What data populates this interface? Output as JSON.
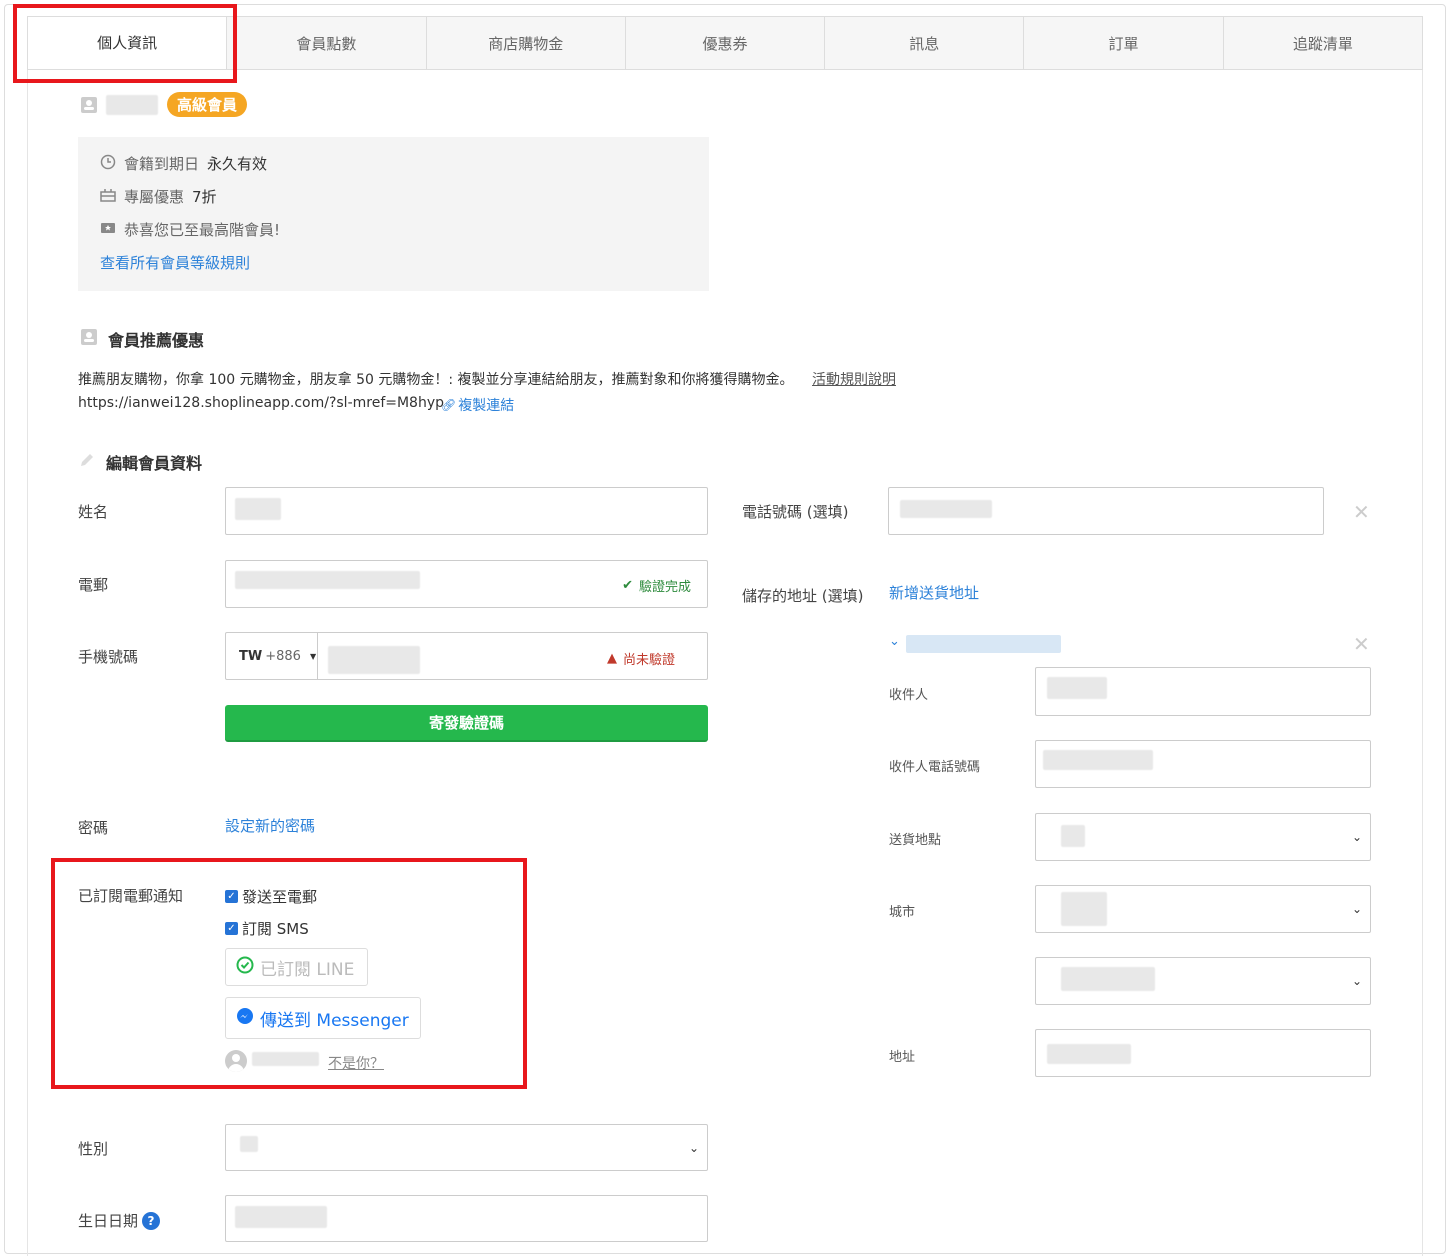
{
  "tabs": [
    "個人資訊",
    "會員點數",
    "商店購物金",
    "優惠券",
    "訊息",
    "訂單",
    "追蹤清單"
  ],
  "member": {
    "tier_badge": "高級會員",
    "expiry_label": "會籍到期日",
    "expiry_value": "永久有效",
    "discount_label": "專屬優惠",
    "discount_value": "7折",
    "congrats": "恭喜您已至最高階會員!",
    "rules_link": "查看所有會員等級規則"
  },
  "referral": {
    "title": "會員推薦優惠",
    "description": "推薦朋友購物，你拿 100 元購物金，朋友拿 50 元購物金！: 複製並分享連結給朋友，推薦對象和你將獲得購物金。",
    "rules_link": "活動規則說明",
    "url": "https://ianwei128.shoplineapp.com/?sl-mref=M8hyp",
    "copy_link": "複製連結"
  },
  "edit": {
    "title": "編輯會員資料",
    "name_label": "姓名",
    "email_label": "電郵",
    "email_verified": "驗證完成",
    "mobile_label": "手機號碼",
    "country_code": "TW",
    "dial_code": "+886",
    "mobile_unverified": "尚未驗證",
    "send_code_button": "寄發驗證碼",
    "password_label": "密碼",
    "password_link": "設定新的密碼",
    "subscribe_label": "已訂閱電郵通知",
    "subscribe_email": "發送至電郵",
    "subscribe_sms": "訂閱 SMS",
    "line_button": "已訂閱 LINE",
    "messenger_button": "傳送到 Messenger",
    "not_you": "不是你？",
    "gender_label": "性別",
    "birthday_label": "生日日期",
    "phone_label": "電話號碼 (選填)",
    "address_label": "儲存的地址 (選填)",
    "add_address_link": "新增送貨地址",
    "recipient_label": "收件人",
    "recipient_phone_label": "收件人電話號碼",
    "delivery_location_label": "送貨地點",
    "city_label": "城市",
    "street_label": "地址"
  },
  "colors": {
    "accent": "#2d82d9",
    "green": "#25b84d",
    "badge": "#f5a623",
    "highlight_red": "#e8171c"
  }
}
